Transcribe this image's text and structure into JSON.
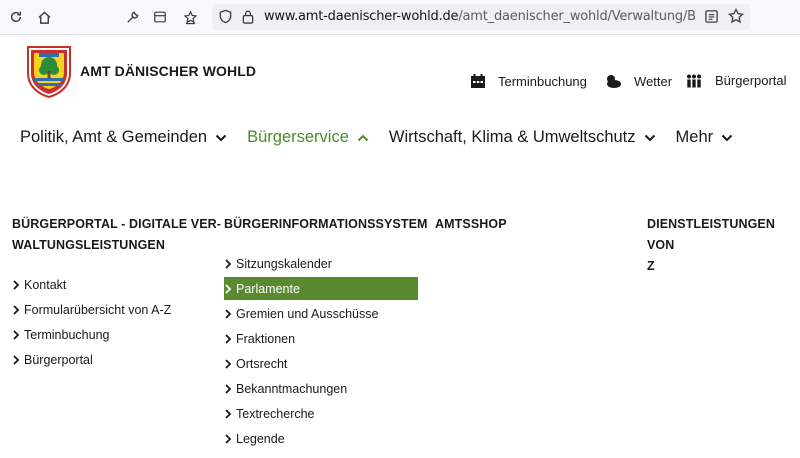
{
  "browser": {
    "url_host": "www.amt-daenischer-wohld.de",
    "url_path": "/amt_daenischer_wohld/Verwaltung/Bürgerinformati"
  },
  "header": {
    "brand": "AMT DÄNISCHER WOHLD",
    "services": [
      {
        "label": "Terminbuchung",
        "icon": "calendar-icon"
      },
      {
        "label": "Wetter",
        "icon": "weather-icon"
      },
      {
        "label": "Bürgerportal",
        "icon": "people-icon"
      }
    ]
  },
  "nav": [
    {
      "label": "Politik, Amt & Gemeinden",
      "active": false
    },
    {
      "label": "Bürgerservice",
      "active": true
    },
    {
      "label": "Wirtschaft, Klima & Umweltschutz",
      "active": false
    },
    {
      "label": "Mehr",
      "active": false
    }
  ],
  "megamenu": {
    "col1": {
      "heading_line1": "BÜRGERPORTAL - DIGITALE VER-",
      "heading_line2": "WALTUNGSLEISTUNGEN",
      "links": [
        "Kontakt",
        "Formularübersicht von A-Z",
        "Terminbuchung",
        "Bürgerportal"
      ]
    },
    "col2": {
      "heading": "BÜRGERINFORMATIONSSYSTEM",
      "links": [
        "Sitzungskalender",
        "Parlamente",
        "Gremien und Ausschüsse",
        "Fraktionen",
        "Ortsrecht",
        "Bekanntmachungen",
        "Textrecherche",
        "Legende"
      ],
      "selected": "Parlamente"
    },
    "col3": {
      "heading": "AMTSSHOP"
    },
    "col4": {
      "heading_line1": "DIENSTLEISTUNGEN VON",
      "heading_line2": "Z"
    }
  },
  "colors": {
    "accent": "#4e8b2b",
    "selected_bg": "#5a8a30"
  }
}
